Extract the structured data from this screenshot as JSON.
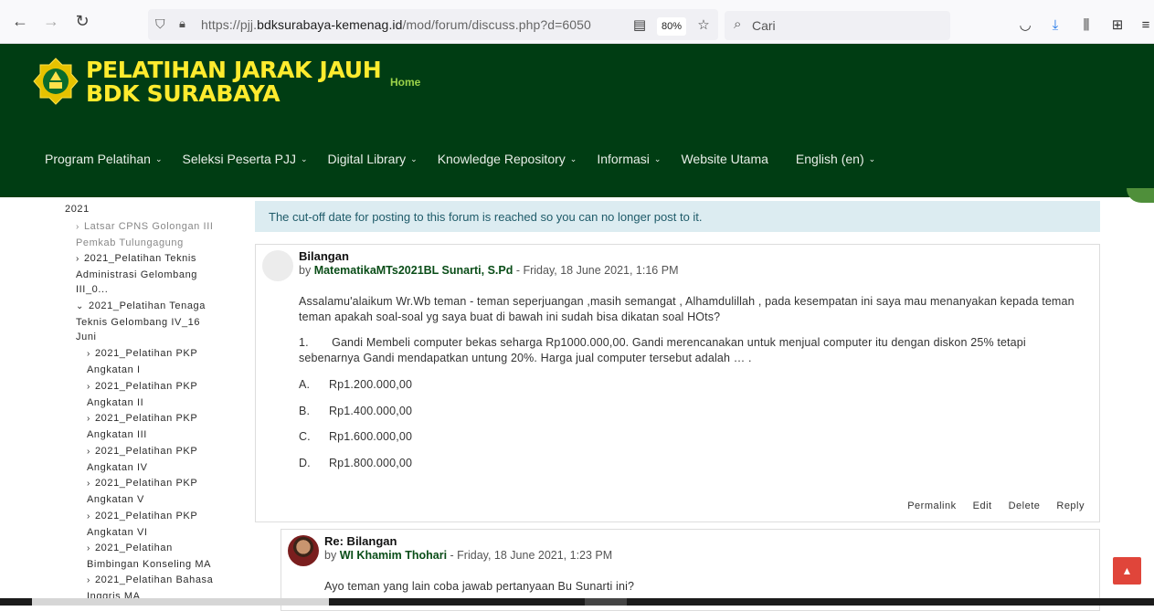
{
  "browser": {
    "url_prefix": "https://pjj.",
    "url_domain": "bdksurabaya-kemenag.id",
    "url_path": "/mod/forum/discuss.php?d=6050",
    "zoom": "80%",
    "search_placeholder": "Cari"
  },
  "header": {
    "brand_line1": "PELATIHAN JARAK JAUH",
    "brand_line2": "BDK SURABAYA",
    "home": "Home",
    "nav": [
      {
        "label": "Program Pelatihan",
        "chev": "⌄"
      },
      {
        "label": "Seleksi Peserta PJJ",
        "chev": "⌄"
      },
      {
        "label": "Digital Library",
        "chev": "⌄"
      },
      {
        "label": "Knowledge Repository",
        "chev": "⌄"
      },
      {
        "label": "Informasi",
        "chev": "⌄"
      },
      {
        "label": "Website Utama",
        "chev": ""
      },
      {
        "label": "English (en)",
        "chev": "⌄"
      }
    ]
  },
  "sidebar": {
    "year": "2021",
    "latsar_line1": "Latsar CPNS Golongan III",
    "latsar_line2": "Pemkab Tulungagung",
    "tekadm_line1": "2021_Pelatihan Teknis",
    "tekadm_line2": "Administrasi Gelombang",
    "tekadm_line3": "III_0...",
    "tenaga_line1": "2021_Pelatihan Tenaga",
    "tenaga_line2": "Teknis Gelombang IV_16",
    "tenaga_line3": "Juni",
    "pkp": [
      {
        "line1": "2021_Pelatihan PKP",
        "line2": "Angkatan I"
      },
      {
        "line1": "2021_Pelatihan PKP",
        "line2": "Angkatan II"
      },
      {
        "line1": "2021_Pelatihan PKP",
        "line2": "Angkatan III"
      },
      {
        "line1": "2021_Pelatihan PKP",
        "line2": "Angkatan IV"
      },
      {
        "line1": "2021_Pelatihan PKP",
        "line2": "Angkatan V"
      },
      {
        "line1": "2021_Pelatihan PKP",
        "line2": "Angkatan VI"
      }
    ],
    "bk_line1": "2021_Pelatihan",
    "bk_line2": "Bimbingan Konseling MA",
    "bing_line1": "2021_Pelatihan Bahasa",
    "bing_line2": "Inggris MA"
  },
  "notice": "The cut-off date for posting to this forum is reached so you can no longer post to it.",
  "post": {
    "subject": "Bilangan",
    "by": "by",
    "author": "MatematikaMTs2021BL Sunarti, S.Pd",
    "date": " - Friday, 18 June 2021, 1:16 PM",
    "intro": "Assalamu'alaikum  Wr.Wb teman - teman seperjuangan ,masih semangat  , Alhamdulillah , pada kesempatan ini   saya mau menanyakan kepada teman teman apakah soal-soal yg saya buat di bawah ini sudah bisa dikatan  soal HOts?",
    "question": "1.       Gandi Membeli computer bekas seharga Rp1000.000,00. Gandi merencanakan untuk menjual computer itu dengan diskon 25% tetapi sebenarnya Gandi mendapatkan untung 20%. Harga jual computer tersebut adalah … .",
    "options": [
      {
        "letter": "A.",
        "text": "Rp1.200.000,00"
      },
      {
        "letter": "B.",
        "text": "Rp1.400.000,00"
      },
      {
        "letter": "C.",
        "text": "Rp1.600.000,00"
      },
      {
        "letter": "D.",
        "text": "Rp1.800.000,00"
      }
    ],
    "actions": [
      "Permalink",
      "Edit",
      "Delete",
      "Reply"
    ]
  },
  "reply": {
    "subject": "Re: Bilangan",
    "by": "by",
    "author": "WI Khamim Thohari",
    "date": " - Friday, 18 June 2021, 1:23 PM",
    "body": "Ayo teman yang lain coba jawab pertanyaan Bu Sunarti ini?"
  },
  "colors": {
    "header_bg": "#003d13",
    "brand": "#ffeb2e",
    "notice_bg": "#dcecf1",
    "scroll_top": "#e0453a"
  }
}
